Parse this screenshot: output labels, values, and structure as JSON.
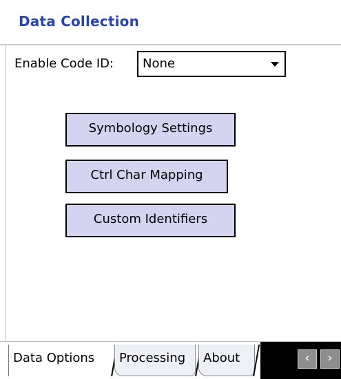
{
  "window": {
    "title": "Data Collection"
  },
  "code_id": {
    "label": "Enable Code ID:",
    "selected": "None"
  },
  "buttons": {
    "symbology": "Symbology Settings",
    "ctrl_char": "Ctrl Char Mapping",
    "custom_identifiers": "Custom Identifiers"
  },
  "tabs": [
    {
      "label": "Data Options",
      "active": true
    },
    {
      "label": "Processing",
      "active": false
    },
    {
      "label": "About",
      "active": false
    }
  ],
  "nav": {
    "left_glyph": "‹",
    "right_glyph": "›",
    "left_icon": "chevron-left-icon",
    "right_icon": "chevron-right-icon"
  },
  "colors": {
    "title": "#2545b3",
    "button_fill": "#d4d4f0"
  }
}
